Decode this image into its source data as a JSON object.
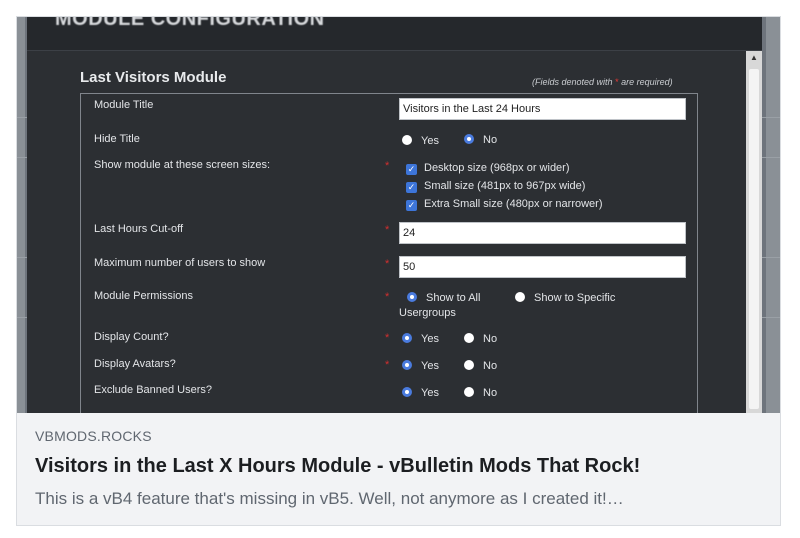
{
  "card": {
    "domain": "VBMODS.ROCKS",
    "title": "Visitors in the Last X Hours Module - vBulletin Mods That Rock!",
    "description": "This is a vB4 feature that's missing in vB5. Well, not anymore as I created it!…"
  },
  "modal": {
    "header_title": "MODULE CONFIGURATION",
    "section_title": "Last Visitors Module",
    "required_note_prefix": "(Fields denoted with",
    "required_note_star": "*",
    "required_note_suffix": "are required)"
  },
  "form": {
    "module_title": {
      "label": "Module Title",
      "value": "Visitors in the Last 24 Hours"
    },
    "hide_title": {
      "label": "Hide Title",
      "yes": "Yes",
      "no": "No",
      "selected": "No"
    },
    "screen_sizes": {
      "label": "Show module at these screen sizes:",
      "options": [
        {
          "label": "Desktop size (968px or wider)",
          "checked": true
        },
        {
          "label": "Small size (481px to 967px wide)",
          "checked": true
        },
        {
          "label": "Extra Small size (480px or narrower)",
          "checked": true
        }
      ]
    },
    "cutoff": {
      "label": "Last Hours Cut-off",
      "value": "24"
    },
    "max_users": {
      "label": "Maximum number of users to show",
      "value": "50"
    },
    "permissions": {
      "label": "Module Permissions",
      "show_all": "Show to All",
      "show_specific_line1": "Show to Specific",
      "show_specific_line2": "Usergroups",
      "selected": "Show to All"
    },
    "display_count": {
      "label": "Display Count?",
      "yes": "Yes",
      "no": "No",
      "selected": "Yes"
    },
    "display_avatars": {
      "label": "Display Avatars?",
      "yes": "Yes",
      "no": "No",
      "selected": "Yes"
    },
    "exclude_banned": {
      "label": "Exclude Banned Users?",
      "yes": "Yes",
      "no": "No",
      "selected": "Yes"
    }
  },
  "required_mark": "*",
  "colors": {
    "accent": "#4a7bde",
    "required": "#d32f2f",
    "modal_bg": "#2c2f33"
  }
}
